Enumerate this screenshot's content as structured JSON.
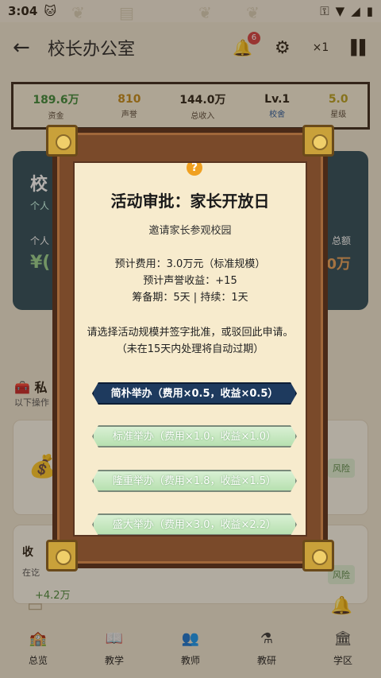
{
  "status_bar": {
    "time": "3:04"
  },
  "header": {
    "back": "←",
    "title": "校长办公室",
    "notif_count": "6",
    "speed": "×1"
  },
  "stats": [
    {
      "value": "189.6万",
      "label": "资金",
      "color": "#3e8a3a"
    },
    {
      "value": "810",
      "label": "声誉",
      "color": "#c48a1a"
    },
    {
      "value": "144.0万",
      "label": "总收入",
      "color": "#333333"
    },
    {
      "value": "Lv.1",
      "label": "校舍",
      "color": "#333333"
    },
    {
      "value": "5.0",
      "label": "星级",
      "color": "#b8a020"
    }
  ],
  "background": {
    "card_title": "校",
    "card_sub": "个人",
    "card_label": "个人",
    "card_amount": "¥(",
    "card_right_label": "总额",
    "card_right_value": "0万",
    "section_title": "私",
    "section_sub": "以下操作",
    "risk_label_1": "风险",
    "risk_label_2": "风险",
    "risk_label_3": "风险",
    "card2_title": "收",
    "card2_sub": "在讫",
    "card2_num": "+4.2万"
  },
  "modal": {
    "help": "?",
    "title": "活动审批：家长开放日",
    "subtitle": "邀请家长参观校园",
    "cost": "预计费用：3.0万元（标准规模）",
    "reputation": "预计声誉收益：+15",
    "schedule": "筹备期：5天 | 持续：1天",
    "prompt": "请选择活动规模并签字批准，或驳回此申请。",
    "expire": "（未在15天内处理将自动过期）",
    "options": [
      {
        "label": "简朴举办（费用×0.5，收益×0.5）"
      },
      {
        "label": "标准举办（费用×1.0，收益×1.0）"
      },
      {
        "label": "隆重举办（费用×1.8，收益×1.5）"
      },
      {
        "label": "盛大举办（费用×3.0，收益×2.2）"
      }
    ]
  },
  "bottom_nav": [
    {
      "label": "总览"
    },
    {
      "label": "教学"
    },
    {
      "label": "教师"
    },
    {
      "label": "教研"
    },
    {
      "label": "学区"
    }
  ]
}
